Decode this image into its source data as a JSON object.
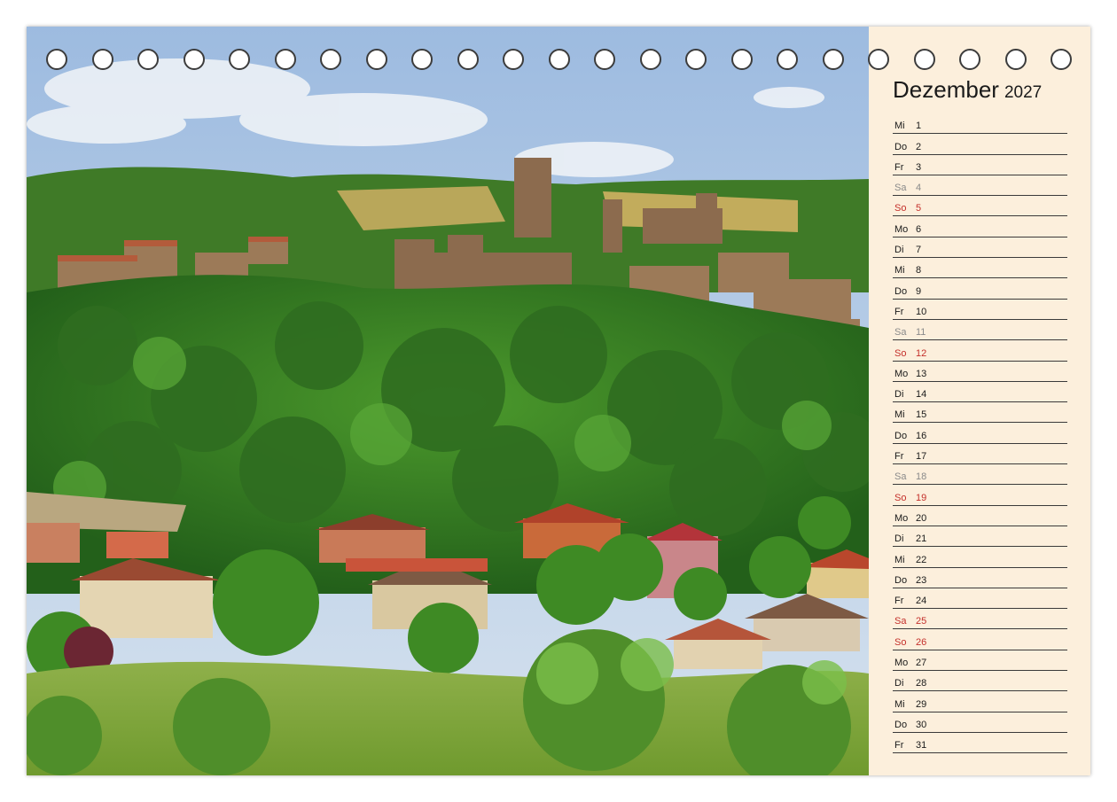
{
  "calendar": {
    "month": "Dezember",
    "year": "2027",
    "days": [
      {
        "wd": "Mi",
        "d": "1",
        "type": "weekday"
      },
      {
        "wd": "Do",
        "d": "2",
        "type": "weekday"
      },
      {
        "wd": "Fr",
        "d": "3",
        "type": "weekday"
      },
      {
        "wd": "Sa",
        "d": "4",
        "type": "saturday"
      },
      {
        "wd": "So",
        "d": "5",
        "type": "sunday"
      },
      {
        "wd": "Mo",
        "d": "6",
        "type": "weekday"
      },
      {
        "wd": "Di",
        "d": "7",
        "type": "weekday"
      },
      {
        "wd": "Mi",
        "d": "8",
        "type": "weekday"
      },
      {
        "wd": "Do",
        "d": "9",
        "type": "weekday"
      },
      {
        "wd": "Fr",
        "d": "10",
        "type": "weekday"
      },
      {
        "wd": "Sa",
        "d": "11",
        "type": "saturday"
      },
      {
        "wd": "So",
        "d": "12",
        "type": "sunday"
      },
      {
        "wd": "Mo",
        "d": "13",
        "type": "weekday"
      },
      {
        "wd": "Di",
        "d": "14",
        "type": "weekday"
      },
      {
        "wd": "Mi",
        "d": "15",
        "type": "weekday"
      },
      {
        "wd": "Do",
        "d": "16",
        "type": "weekday"
      },
      {
        "wd": "Fr",
        "d": "17",
        "type": "weekday"
      },
      {
        "wd": "Sa",
        "d": "18",
        "type": "saturday"
      },
      {
        "wd": "So",
        "d": "19",
        "type": "sunday"
      },
      {
        "wd": "Mo",
        "d": "20",
        "type": "weekday"
      },
      {
        "wd": "Di",
        "d": "21",
        "type": "weekday"
      },
      {
        "wd": "Mi",
        "d": "22",
        "type": "weekday"
      },
      {
        "wd": "Do",
        "d": "23",
        "type": "weekday"
      },
      {
        "wd": "Fr",
        "d": "24",
        "type": "weekday"
      },
      {
        "wd": "Sa",
        "d": "25",
        "type": "sunday"
      },
      {
        "wd": "So",
        "d": "26",
        "type": "sunday"
      },
      {
        "wd": "Mo",
        "d": "27",
        "type": "weekday"
      },
      {
        "wd": "Di",
        "d": "28",
        "type": "weekday"
      },
      {
        "wd": "Mi",
        "d": "29",
        "type": "weekday"
      },
      {
        "wd": "Do",
        "d": "30",
        "type": "weekday"
      },
      {
        "wd": "Fr",
        "d": "31",
        "type": "weekday"
      }
    ]
  },
  "binding": {
    "ring_count": 23
  },
  "colors": {
    "panel_background": "#fcefdc",
    "sunday_holiday_red": "#c4302b",
    "saturday_gray": "#8a8a8a",
    "ring_stroke": "#3c3c3c"
  }
}
